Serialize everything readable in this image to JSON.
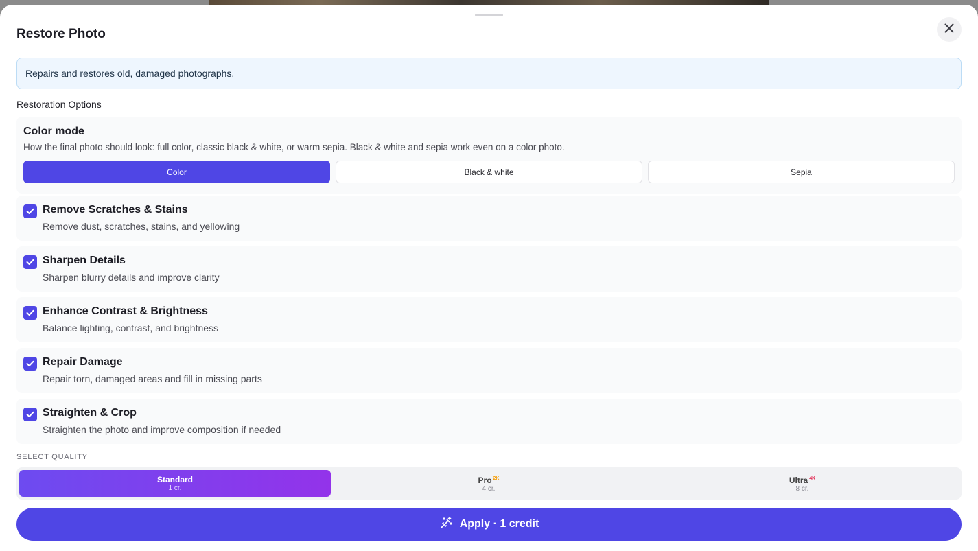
{
  "dialog": {
    "title": "Restore Photo",
    "description": "Repairs and restores old, damaged photographs."
  },
  "restoration": {
    "section_label": "Restoration Options",
    "color_mode": {
      "title": "Color mode",
      "description": "How the final photo should look: full color, classic black & white, or warm sepia. Black & white and sepia work even on a color photo.",
      "options": [
        "Color",
        "Black & white",
        "Sepia"
      ],
      "selected": "Color"
    },
    "options": [
      {
        "title": "Remove Scratches & Stains",
        "description": "Remove dust, scratches, stains, and yellowing",
        "checked": true
      },
      {
        "title": "Sharpen Details",
        "description": "Sharpen blurry details and improve clarity",
        "checked": true
      },
      {
        "title": "Enhance Contrast & Brightness",
        "description": "Balance lighting, contrast, and brightness",
        "checked": true
      },
      {
        "title": "Repair Damage",
        "description": "Repair torn, damaged areas and fill in missing parts",
        "checked": true
      },
      {
        "title": "Straighten & Crop",
        "description": "Straighten the photo and improve composition if needed",
        "checked": true
      }
    ]
  },
  "quality": {
    "label": "SELECT QUALITY",
    "options": [
      {
        "name": "Standard",
        "badge": "",
        "cost": "1 cr."
      },
      {
        "name": "Pro",
        "badge": "2K",
        "cost": "4 cr."
      },
      {
        "name": "Ultra",
        "badge": "4K",
        "cost": "8 cr."
      }
    ],
    "selected": "Standard",
    "badge_colors": {
      "2K": "#f59e0b",
      "4K": "#e11d48"
    }
  },
  "apply": {
    "label": "Apply · 1 credit",
    "icon": "magic-wand-icon"
  },
  "colors": {
    "accent": "#4f46e5"
  }
}
